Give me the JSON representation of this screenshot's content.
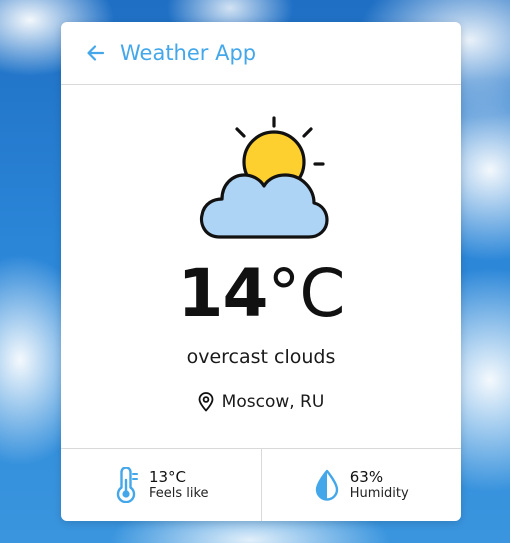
{
  "header": {
    "title": "Weather App",
    "back_icon": "arrow-left-icon",
    "accent_color": "#44a7ea"
  },
  "weather": {
    "icon": "partly-cloudy-icon",
    "temperature": "14",
    "unit": "°C",
    "description": "overcast clouds",
    "location_icon": "map-pin-icon",
    "location": "Moscow, RU"
  },
  "stats": {
    "feels_like": {
      "icon": "thermometer-icon",
      "value": "13°C",
      "label": "Feels like"
    },
    "humidity": {
      "icon": "water-drop-icon",
      "value": "63%",
      "label": "Humidity"
    }
  }
}
